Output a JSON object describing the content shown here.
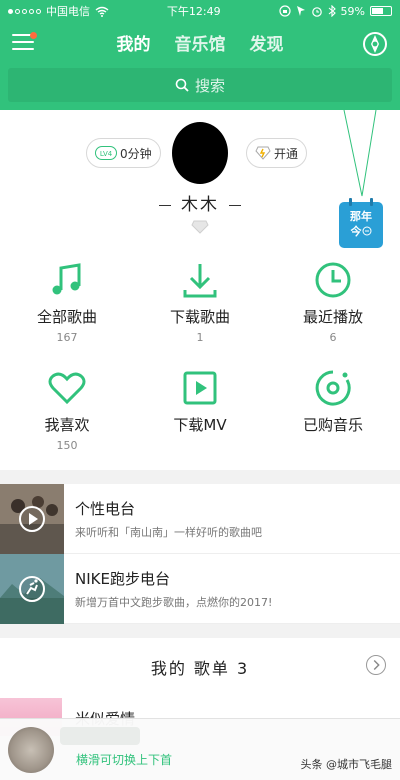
{
  "status_bar": {
    "carrier": "中国电信",
    "time": "下午12:49",
    "battery": "59%",
    "battery_level": 0.59
  },
  "nav": {
    "tabs": [
      "我的",
      "音乐馆",
      "发现"
    ],
    "active_tab": 0
  },
  "search": {
    "placeholder": "搜索"
  },
  "profile": {
    "listen_time": "0分钟",
    "open_label": "开通",
    "username": "木木",
    "year_badge": {
      "line1": "那年",
      "line2": "今"
    }
  },
  "grid": [
    {
      "icon": "music-note-icon",
      "label": "全部歌曲",
      "count": "167"
    },
    {
      "icon": "download-icon",
      "label": "下载歌曲",
      "count": "1"
    },
    {
      "icon": "clock-icon",
      "label": "最近播放",
      "count": "6"
    },
    {
      "icon": "heart-icon",
      "label": "我喜欢",
      "count": "150"
    },
    {
      "icon": "play-box-icon",
      "label": "下载MV",
      "count": ""
    },
    {
      "icon": "disc-icon",
      "label": "已购音乐",
      "count": ""
    }
  ],
  "radios": [
    {
      "title": "个性电台",
      "subtitle": "来听听和「南山南」一样好听的歌曲吧"
    },
    {
      "title": "NIKE跑步电台",
      "subtitle": "新增万首中文跑步歌曲，点燃你的2017!"
    }
  ],
  "playlist": {
    "title": "我的 歌单 3",
    "first_item": "米似爱情"
  },
  "player": {
    "hint": "横滑可切换上下首"
  },
  "watermark": "头条 @城市飞毛腿",
  "colors": {
    "accent": "#31c27c",
    "search_bg": "#2db573",
    "calendar": "#2a9fd6"
  }
}
